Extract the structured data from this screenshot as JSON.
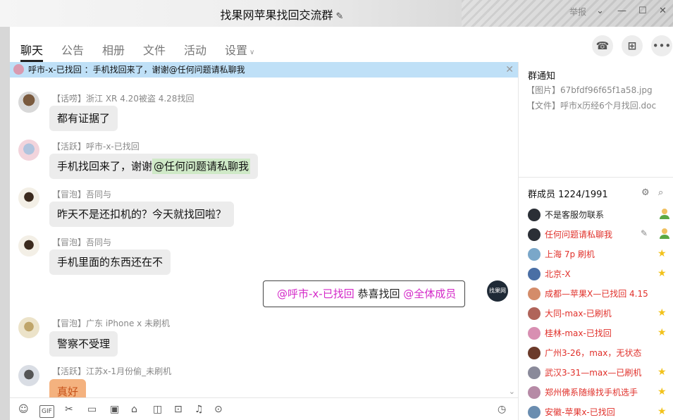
{
  "window": {
    "title": "找果网苹果找回交流群",
    "ctrl_text": "举报"
  },
  "tabs": [
    {
      "label": "聊天",
      "active": true
    },
    {
      "label": "公告"
    },
    {
      "label": "相册"
    },
    {
      "label": "文件"
    },
    {
      "label": "活动"
    },
    {
      "label": "设置"
    }
  ],
  "pinned": {
    "text": "呼市-x-已找回 ：手机找回来了，谢谢@任何问题请私聊我"
  },
  "messages": [
    {
      "sender": "【话唠】浙江 XR 4.20被盗 4.28找回",
      "text": "都有证据了"
    },
    {
      "sender": "【活跃】呼市-x-已找回",
      "text": "手机找回来了，谢谢",
      "mention": "@任何问题请私聊我"
    },
    {
      "sender": "【冒泡】吾同与",
      "text": "昨天不是还扣机的？今天就找回啦？"
    },
    {
      "sender": "【冒泡】吾同与",
      "text": "手机里面的东西还在不"
    },
    {
      "sender": "【冒泡】广东 iPhone x 未刷机",
      "text": "警察不受理"
    },
    {
      "sender": "【活跃】江苏x-1月份偷_未刷机",
      "text": "真好"
    }
  ],
  "outgoing": {
    "mention1": "@呼市-x-已找回",
    "text": " 恭喜找回 ",
    "mention2": "@全体成员",
    "avatar_text": "找果网"
  },
  "notice": {
    "title": "群通知",
    "lines": [
      "【图片】67bfdf96f65f1a58.jpg",
      "【文件】呼市x历经6个月找回.doc"
    ]
  },
  "members": {
    "title": "群成员 1224/1991",
    "list": [
      {
        "name": "不是客服勿联系",
        "color": "#222222",
        "badge": "owner"
      },
      {
        "name": "任何问题请私聊我",
        "color": "#e0302a",
        "badge": "owner"
      },
      {
        "name": "上海 7p  刷机",
        "color": "#e0302a",
        "badge": "star"
      },
      {
        "name": "北京-X",
        "color": "#e0302a",
        "badge": "star"
      },
      {
        "name": "成都—苹果X—已找回 4.15",
        "color": "#e0302a",
        "badge": ""
      },
      {
        "name": "大同-max-已刷机",
        "color": "#e0302a",
        "badge": "star"
      },
      {
        "name": "桂林-max-已找回",
        "color": "#e0302a",
        "badge": "star"
      },
      {
        "name": "广州3-26，max，无状态",
        "color": "#e0302a",
        "badge": ""
      },
      {
        "name": "武汉3-31—max—已刷机",
        "color": "#e0302a",
        "badge": "star"
      },
      {
        "name": "郑州佛系随缘找手机选手",
        "color": "#e0302a",
        "badge": "star"
      },
      {
        "name": "安徽-苹果x-已找回",
        "color": "#e0302a",
        "badge": "star"
      }
    ]
  },
  "colors": {
    "pinned_bg": "#bfe0f7",
    "mention_bg": "#cfe9c7",
    "mention_pink": "#d428c8",
    "member_red": "#e0302a",
    "star": "#f2c21b"
  }
}
